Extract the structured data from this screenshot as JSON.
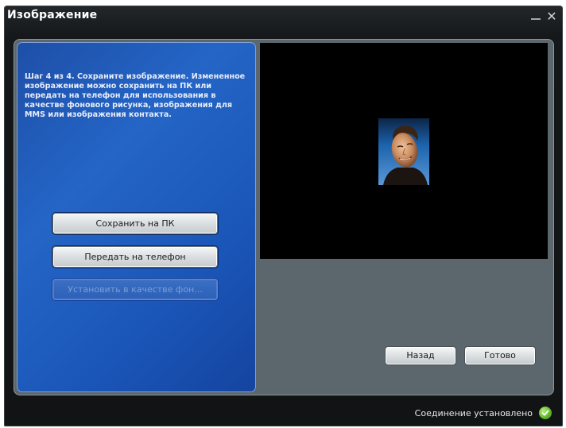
{
  "window": {
    "title": "Изображение",
    "minimize_icon": "minimize-icon",
    "close_icon": "close-icon",
    "close_glyph": "✕"
  },
  "left_panel": {
    "instructions": "Шаг 4 из 4. Сохраните изображение. Измененное изображение можно сохранить на ПК или передать на телефон для использования в качестве фонового рисунка, изображения для MMS или изображения контакта.",
    "buttons": {
      "save_pc": "Сохранить на ПК",
      "send_phone": "Передать на телефон",
      "set_background": "Установить в качестве фон..."
    }
  },
  "preview": {
    "image": "portrait-photo"
  },
  "navigation": {
    "back": "Назад",
    "done": "Готово"
  },
  "status": {
    "text": "Соединение установлено",
    "icon": "check-icon",
    "color": "#5fb42a"
  },
  "colors": {
    "panel_blue": "#2465c6",
    "frame_gray": "#5b666d",
    "window_dark": "#15181a"
  }
}
